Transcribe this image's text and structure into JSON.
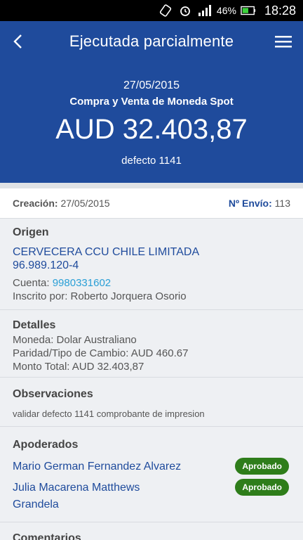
{
  "status_bar": {
    "battery_pct": "46%",
    "time": "18:28"
  },
  "appbar": {
    "title": "Ejecutada parcialmente"
  },
  "hero": {
    "date": "27/05/2015",
    "operation": "Compra y Venta de Moneda Spot",
    "amount": "AUD 32.403,87",
    "reference": "defecto 1141"
  },
  "meta": {
    "creation_label": "Creación:",
    "creation_value": "27/05/2015",
    "envio_label": "Nº Envío:",
    "envio_value": "113"
  },
  "origen": {
    "title": "Origen",
    "company": "CERVECERA CCU CHILE LIMITADA",
    "rut": "96.989.120-4",
    "cuenta_label": "Cuenta:",
    "cuenta_value": "9980331602",
    "inscrito": "Inscrito por: Roberto Jorquera Osorio"
  },
  "detalles": {
    "title": "Detalles",
    "moneda": "Moneda: Dolar Australiano",
    "paridad": "Paridad/Tipo de Cambio: AUD 460.67",
    "monto": "Monto Total: AUD 32.403,87"
  },
  "observaciones": {
    "title": "Observaciones",
    "text": "validar defecto 1141 comprobante de impresion"
  },
  "apoderados": {
    "title": "Apoderados",
    "items": [
      {
        "name": "Mario German Fernandez Alvarez",
        "status": "Aprobado"
      },
      {
        "name_line1": "Julia Macarena Matthews",
        "name_line2": "Grandela",
        "status": "Aprobado"
      }
    ]
  },
  "comentarios": {
    "title": "Comentarios"
  },
  "colors": {
    "primary": "#1f4b9c",
    "approved": "#2e7d1a",
    "link": "#2a9fd6"
  }
}
